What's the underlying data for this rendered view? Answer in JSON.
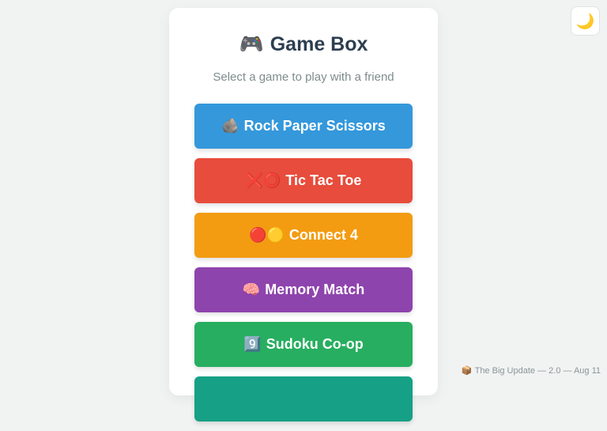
{
  "header": {
    "title_icon": "🎮",
    "title": "Game Box",
    "subtitle": "Select a game to play with a friend"
  },
  "games": [
    {
      "icon": "🪨",
      "label": "Rock Paper Scissors",
      "color": "#3498db"
    },
    {
      "icon": "❌⭕",
      "label": "Tic Tac Toe",
      "color": "#e74c3c"
    },
    {
      "icon": "🔴🟡",
      "label": "Connect 4",
      "color": "#f39c12"
    },
    {
      "icon": "🧠",
      "label": "Memory Match",
      "color": "#8e44ad"
    },
    {
      "icon": "9️⃣",
      "label": "Sudoku Co-op",
      "color": "#27ae60"
    },
    {
      "icon": "",
      "label": "",
      "color": "#16a085"
    }
  ],
  "theme_toggle": {
    "icon": "🌙",
    "icon_name": "moon-icon"
  },
  "footer": {
    "icon": "📦",
    "text": "The Big Update — 2.0 — Aug 11"
  }
}
